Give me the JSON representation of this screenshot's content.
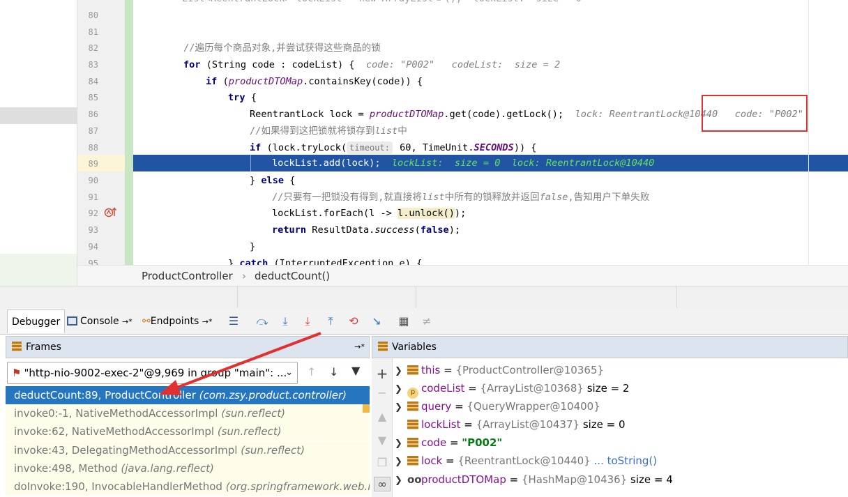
{
  "editor": {
    "lines": [
      {
        "num": "80"
      },
      {
        "num": "81"
      },
      {
        "num": "82",
        "comment": "//遍历每个商品对象,并尝试获得这些商品的锁"
      },
      {
        "num": "83",
        "kw": "for",
        "code": " (String code : codeList) {",
        "hint": "code: \"P002\"   codeList:  size = 2"
      },
      {
        "num": "84",
        "kw": "if",
        "code_a": " (",
        "field": "productDTOMap",
        "code_b": ".containsKey(code)) {"
      },
      {
        "num": "85",
        "kw": "try",
        "code": " {"
      },
      {
        "num": "86",
        "code_a": "ReentrantLock lock = ",
        "field": "productDTOMap",
        "code_b": ".get(code).getLock();",
        "hint": "lock: ReentrantLock@10440   code: \"P002\""
      },
      {
        "num": "87",
        "comment_a": "//如果得到这把锁就将锁存到",
        "comment_it": "list",
        "comment_b": "中"
      },
      {
        "num": "88",
        "kw": "if",
        "code_a": " (lock.tryLock(",
        "param_hint": "timeout:",
        "code_b": " 60, TimeUnit.",
        "const": "SECONDS",
        "code_c": ")) {"
      },
      {
        "num": "89",
        "code": "lockList.add(lock);",
        "inline": "lockList:  size = 0  lock: ReentrantLock@10440"
      },
      {
        "num": "90",
        "code_a": "} ",
        "kw": "else",
        "code_b": " {"
      },
      {
        "num": "91",
        "comment_a": "//只要有一把锁没有得到,就直接将",
        "comment_it": "list",
        "comment_b": "中所有的锁释放并返回",
        "comment_it2": "false",
        "comment_c": ",告知用户下单失败"
      },
      {
        "num": "92",
        "code_a": "lockList.forEach(l -> ",
        "code_hl": "l.unlock()",
        "code_b": ");"
      },
      {
        "num": "93",
        "kw": "return",
        "code_a": " ResultData.",
        "method": "success",
        "code_b": "(",
        "kw2": "false",
        "code_c": ");"
      },
      {
        "num": "94",
        "code": "}"
      },
      {
        "num": "95",
        "code_a": "} ",
        "kw": "catch",
        "code_b": " (InterruptedException e) {"
      }
    ],
    "top_partial": "List<ReentrantLock> lockList = new ArrayList<>();  lockList:  size = 0"
  },
  "breadcrumb": {
    "class_name": "ProductController",
    "method_name": "deductCount()",
    "separator": "›"
  },
  "debugger": {
    "tabs": {
      "debugger": "Debugger",
      "console": "Console",
      "console_suffix": "→*",
      "endpoints": "Endpoints",
      "endpoints_suffix": "→*"
    },
    "frames_title": "Frames",
    "variables_title": "Variables",
    "pin": "→*",
    "thread": "\"http-nio-9002-exec-2\"@9,969 in group \"main\": ...",
    "frames": [
      {
        "method": "deductCount:89, ProductController",
        "pkg": "(com.zsy.product.controller)"
      },
      {
        "method": "invoke0:-1, NativeMethodAccessorImpl",
        "pkg": "(sun.reflect)"
      },
      {
        "method": "invoke:62, NativeMethodAccessorImpl",
        "pkg": "(sun.reflect)"
      },
      {
        "method": "invoke:43, DelegatingMethodAccessorImpl",
        "pkg": "(sun.reflect)"
      },
      {
        "method": "invoke:498, Method",
        "pkg": "(java.lang.reflect)"
      },
      {
        "method": "doInvoke:190, InvocableHandlerMethod",
        "pkg": "(org.springframework.web.m"
      }
    ],
    "variables": [
      {
        "name": "this",
        "value": "{ProductController@10365}",
        "extra": ""
      },
      {
        "name": "codeList",
        "value": "{ArrayList@10368}",
        "extra": "size = 2"
      },
      {
        "name": "query",
        "value": "{QueryWrapper@10400}",
        "extra": ""
      },
      {
        "name": "lockList",
        "value": "{ArrayList@10437}",
        "extra": "size = 0"
      },
      {
        "name": "code",
        "value": "\"P002\"",
        "extra": ""
      },
      {
        "name": "lock",
        "value": "{ReentrantLock@10440}",
        "extra": "... toString()"
      },
      {
        "name": "productDTOMap",
        "value": "{HashMap@10436}",
        "extra": "size = 4"
      }
    ],
    "eq": " = "
  },
  "colors": {
    "exec_line": "#2154a3",
    "selected_frame": "#2675bf",
    "annotation_red": "#e03030"
  }
}
